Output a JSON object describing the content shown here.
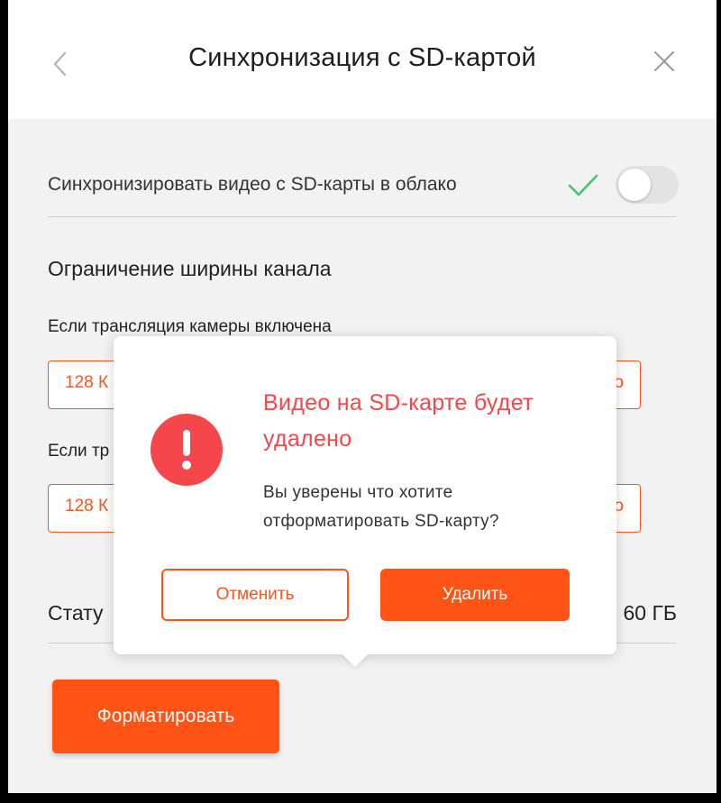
{
  "header": {
    "title": "Синхронизация с SD-картой",
    "back_icon": "chevron-left-icon",
    "close_icon": "close-icon"
  },
  "sync": {
    "label": "Синхронизировать видео с SD-карты в облако",
    "check_icon": "checkmark-icon",
    "toggle_on": false
  },
  "bandwidth": {
    "title": "Ограничение ширины канала",
    "field1": {
      "label": "Если трансляция камеры включена",
      "value": "128 К",
      "suffix": "о"
    },
    "field2": {
      "label": "Если тр",
      "value": "128 К",
      "suffix": "о"
    }
  },
  "status": {
    "label": "Стату",
    "value": "60 ГБ"
  },
  "format_button": {
    "label": "Форматировать"
  },
  "dialog": {
    "icon": "exclamation-icon",
    "title": "Видео на SD-карте будет удалено",
    "text": "Вы уверены что хотите отформатировать SD-карту?",
    "cancel_label": "Отменить",
    "delete_label": "Удалить"
  },
  "colors": {
    "accent": "#ff5416",
    "alert": "#f5474b",
    "check": "#3ec96b",
    "background": "#f2f2f2"
  }
}
